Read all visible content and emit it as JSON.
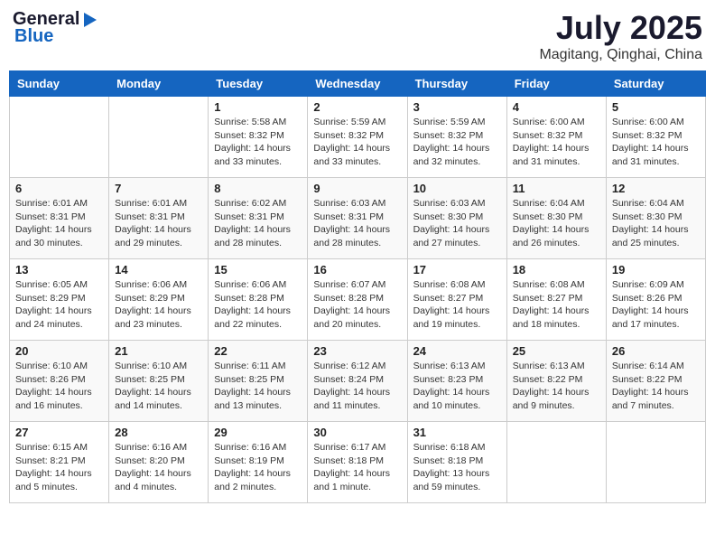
{
  "header": {
    "logo_general": "General",
    "logo_blue": "Blue",
    "month_title": "July 2025",
    "subtitle": "Magitang, Qinghai, China"
  },
  "weekdays": [
    "Sunday",
    "Monday",
    "Tuesday",
    "Wednesday",
    "Thursday",
    "Friday",
    "Saturday"
  ],
  "weeks": [
    [
      {
        "day": "",
        "info": ""
      },
      {
        "day": "",
        "info": ""
      },
      {
        "day": "1",
        "info": "Sunrise: 5:58 AM\nSunset: 8:32 PM\nDaylight: 14 hours and 33 minutes."
      },
      {
        "day": "2",
        "info": "Sunrise: 5:59 AM\nSunset: 8:32 PM\nDaylight: 14 hours and 33 minutes."
      },
      {
        "day": "3",
        "info": "Sunrise: 5:59 AM\nSunset: 8:32 PM\nDaylight: 14 hours and 32 minutes."
      },
      {
        "day": "4",
        "info": "Sunrise: 6:00 AM\nSunset: 8:32 PM\nDaylight: 14 hours and 31 minutes."
      },
      {
        "day": "5",
        "info": "Sunrise: 6:00 AM\nSunset: 8:32 PM\nDaylight: 14 hours and 31 minutes."
      }
    ],
    [
      {
        "day": "6",
        "info": "Sunrise: 6:01 AM\nSunset: 8:31 PM\nDaylight: 14 hours and 30 minutes."
      },
      {
        "day": "7",
        "info": "Sunrise: 6:01 AM\nSunset: 8:31 PM\nDaylight: 14 hours and 29 minutes."
      },
      {
        "day": "8",
        "info": "Sunrise: 6:02 AM\nSunset: 8:31 PM\nDaylight: 14 hours and 28 minutes."
      },
      {
        "day": "9",
        "info": "Sunrise: 6:03 AM\nSunset: 8:31 PM\nDaylight: 14 hours and 28 minutes."
      },
      {
        "day": "10",
        "info": "Sunrise: 6:03 AM\nSunset: 8:30 PM\nDaylight: 14 hours and 27 minutes."
      },
      {
        "day": "11",
        "info": "Sunrise: 6:04 AM\nSunset: 8:30 PM\nDaylight: 14 hours and 26 minutes."
      },
      {
        "day": "12",
        "info": "Sunrise: 6:04 AM\nSunset: 8:30 PM\nDaylight: 14 hours and 25 minutes."
      }
    ],
    [
      {
        "day": "13",
        "info": "Sunrise: 6:05 AM\nSunset: 8:29 PM\nDaylight: 14 hours and 24 minutes."
      },
      {
        "day": "14",
        "info": "Sunrise: 6:06 AM\nSunset: 8:29 PM\nDaylight: 14 hours and 23 minutes."
      },
      {
        "day": "15",
        "info": "Sunrise: 6:06 AM\nSunset: 8:28 PM\nDaylight: 14 hours and 22 minutes."
      },
      {
        "day": "16",
        "info": "Sunrise: 6:07 AM\nSunset: 8:28 PM\nDaylight: 14 hours and 20 minutes."
      },
      {
        "day": "17",
        "info": "Sunrise: 6:08 AM\nSunset: 8:27 PM\nDaylight: 14 hours and 19 minutes."
      },
      {
        "day": "18",
        "info": "Sunrise: 6:08 AM\nSunset: 8:27 PM\nDaylight: 14 hours and 18 minutes."
      },
      {
        "day": "19",
        "info": "Sunrise: 6:09 AM\nSunset: 8:26 PM\nDaylight: 14 hours and 17 minutes."
      }
    ],
    [
      {
        "day": "20",
        "info": "Sunrise: 6:10 AM\nSunset: 8:26 PM\nDaylight: 14 hours and 16 minutes."
      },
      {
        "day": "21",
        "info": "Sunrise: 6:10 AM\nSunset: 8:25 PM\nDaylight: 14 hours and 14 minutes."
      },
      {
        "day": "22",
        "info": "Sunrise: 6:11 AM\nSunset: 8:25 PM\nDaylight: 14 hours and 13 minutes."
      },
      {
        "day": "23",
        "info": "Sunrise: 6:12 AM\nSunset: 8:24 PM\nDaylight: 14 hours and 11 minutes."
      },
      {
        "day": "24",
        "info": "Sunrise: 6:13 AM\nSunset: 8:23 PM\nDaylight: 14 hours and 10 minutes."
      },
      {
        "day": "25",
        "info": "Sunrise: 6:13 AM\nSunset: 8:22 PM\nDaylight: 14 hours and 9 minutes."
      },
      {
        "day": "26",
        "info": "Sunrise: 6:14 AM\nSunset: 8:22 PM\nDaylight: 14 hours and 7 minutes."
      }
    ],
    [
      {
        "day": "27",
        "info": "Sunrise: 6:15 AM\nSunset: 8:21 PM\nDaylight: 14 hours and 5 minutes."
      },
      {
        "day": "28",
        "info": "Sunrise: 6:16 AM\nSunset: 8:20 PM\nDaylight: 14 hours and 4 minutes."
      },
      {
        "day": "29",
        "info": "Sunrise: 6:16 AM\nSunset: 8:19 PM\nDaylight: 14 hours and 2 minutes."
      },
      {
        "day": "30",
        "info": "Sunrise: 6:17 AM\nSunset: 8:18 PM\nDaylight: 14 hours and 1 minute."
      },
      {
        "day": "31",
        "info": "Sunrise: 6:18 AM\nSunset: 8:18 PM\nDaylight: 13 hours and 59 minutes."
      },
      {
        "day": "",
        "info": ""
      },
      {
        "day": "",
        "info": ""
      }
    ]
  ]
}
